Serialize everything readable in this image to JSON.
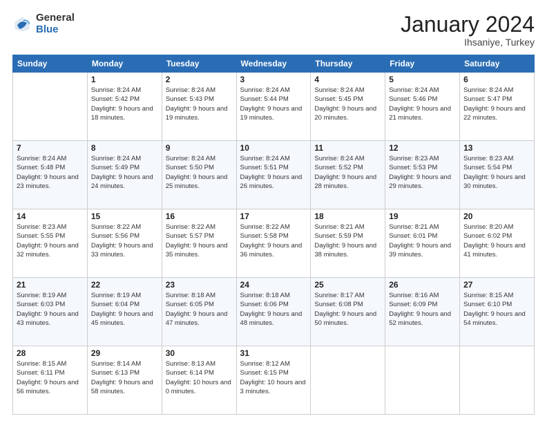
{
  "logo": {
    "general": "General",
    "blue": "Blue"
  },
  "title": "January 2024",
  "location": "Ihsaniye, Turkey",
  "days_of_week": [
    "Sunday",
    "Monday",
    "Tuesday",
    "Wednesday",
    "Thursday",
    "Friday",
    "Saturday"
  ],
  "weeks": [
    [
      {
        "day": "",
        "sunrise": "",
        "sunset": "",
        "daylight": ""
      },
      {
        "day": "1",
        "sunrise": "Sunrise: 8:24 AM",
        "sunset": "Sunset: 5:42 PM",
        "daylight": "Daylight: 9 hours and 18 minutes."
      },
      {
        "day": "2",
        "sunrise": "Sunrise: 8:24 AM",
        "sunset": "Sunset: 5:43 PM",
        "daylight": "Daylight: 9 hours and 19 minutes."
      },
      {
        "day": "3",
        "sunrise": "Sunrise: 8:24 AM",
        "sunset": "Sunset: 5:44 PM",
        "daylight": "Daylight: 9 hours and 19 minutes."
      },
      {
        "day": "4",
        "sunrise": "Sunrise: 8:24 AM",
        "sunset": "Sunset: 5:45 PM",
        "daylight": "Daylight: 9 hours and 20 minutes."
      },
      {
        "day": "5",
        "sunrise": "Sunrise: 8:24 AM",
        "sunset": "Sunset: 5:46 PM",
        "daylight": "Daylight: 9 hours and 21 minutes."
      },
      {
        "day": "6",
        "sunrise": "Sunrise: 8:24 AM",
        "sunset": "Sunset: 5:47 PM",
        "daylight": "Daylight: 9 hours and 22 minutes."
      }
    ],
    [
      {
        "day": "7",
        "sunrise": "Sunrise: 8:24 AM",
        "sunset": "Sunset: 5:48 PM",
        "daylight": "Daylight: 9 hours and 23 minutes."
      },
      {
        "day": "8",
        "sunrise": "Sunrise: 8:24 AM",
        "sunset": "Sunset: 5:49 PM",
        "daylight": "Daylight: 9 hours and 24 minutes."
      },
      {
        "day": "9",
        "sunrise": "Sunrise: 8:24 AM",
        "sunset": "Sunset: 5:50 PM",
        "daylight": "Daylight: 9 hours and 25 minutes."
      },
      {
        "day": "10",
        "sunrise": "Sunrise: 8:24 AM",
        "sunset": "Sunset: 5:51 PM",
        "daylight": "Daylight: 9 hours and 26 minutes."
      },
      {
        "day": "11",
        "sunrise": "Sunrise: 8:24 AM",
        "sunset": "Sunset: 5:52 PM",
        "daylight": "Daylight: 9 hours and 28 minutes."
      },
      {
        "day": "12",
        "sunrise": "Sunrise: 8:23 AM",
        "sunset": "Sunset: 5:53 PM",
        "daylight": "Daylight: 9 hours and 29 minutes."
      },
      {
        "day": "13",
        "sunrise": "Sunrise: 8:23 AM",
        "sunset": "Sunset: 5:54 PM",
        "daylight": "Daylight: 9 hours and 30 minutes."
      }
    ],
    [
      {
        "day": "14",
        "sunrise": "Sunrise: 8:23 AM",
        "sunset": "Sunset: 5:55 PM",
        "daylight": "Daylight: 9 hours and 32 minutes."
      },
      {
        "day": "15",
        "sunrise": "Sunrise: 8:22 AM",
        "sunset": "Sunset: 5:56 PM",
        "daylight": "Daylight: 9 hours and 33 minutes."
      },
      {
        "day": "16",
        "sunrise": "Sunrise: 8:22 AM",
        "sunset": "Sunset: 5:57 PM",
        "daylight": "Daylight: 9 hours and 35 minutes."
      },
      {
        "day": "17",
        "sunrise": "Sunrise: 8:22 AM",
        "sunset": "Sunset: 5:58 PM",
        "daylight": "Daylight: 9 hours and 36 minutes."
      },
      {
        "day": "18",
        "sunrise": "Sunrise: 8:21 AM",
        "sunset": "Sunset: 5:59 PM",
        "daylight": "Daylight: 9 hours and 38 minutes."
      },
      {
        "day": "19",
        "sunrise": "Sunrise: 8:21 AM",
        "sunset": "Sunset: 6:01 PM",
        "daylight": "Daylight: 9 hours and 39 minutes."
      },
      {
        "day": "20",
        "sunrise": "Sunrise: 8:20 AM",
        "sunset": "Sunset: 6:02 PM",
        "daylight": "Daylight: 9 hours and 41 minutes."
      }
    ],
    [
      {
        "day": "21",
        "sunrise": "Sunrise: 8:19 AM",
        "sunset": "Sunset: 6:03 PM",
        "daylight": "Daylight: 9 hours and 43 minutes."
      },
      {
        "day": "22",
        "sunrise": "Sunrise: 8:19 AM",
        "sunset": "Sunset: 6:04 PM",
        "daylight": "Daylight: 9 hours and 45 minutes."
      },
      {
        "day": "23",
        "sunrise": "Sunrise: 8:18 AM",
        "sunset": "Sunset: 6:05 PM",
        "daylight": "Daylight: 9 hours and 47 minutes."
      },
      {
        "day": "24",
        "sunrise": "Sunrise: 8:18 AM",
        "sunset": "Sunset: 6:06 PM",
        "daylight": "Daylight: 9 hours and 48 minutes."
      },
      {
        "day": "25",
        "sunrise": "Sunrise: 8:17 AM",
        "sunset": "Sunset: 6:08 PM",
        "daylight": "Daylight: 9 hours and 50 minutes."
      },
      {
        "day": "26",
        "sunrise": "Sunrise: 8:16 AM",
        "sunset": "Sunset: 6:09 PM",
        "daylight": "Daylight: 9 hours and 52 minutes."
      },
      {
        "day": "27",
        "sunrise": "Sunrise: 8:15 AM",
        "sunset": "Sunset: 6:10 PM",
        "daylight": "Daylight: 9 hours and 54 minutes."
      }
    ],
    [
      {
        "day": "28",
        "sunrise": "Sunrise: 8:15 AM",
        "sunset": "Sunset: 6:11 PM",
        "daylight": "Daylight: 9 hours and 56 minutes."
      },
      {
        "day": "29",
        "sunrise": "Sunrise: 8:14 AM",
        "sunset": "Sunset: 6:13 PM",
        "daylight": "Daylight: 9 hours and 58 minutes."
      },
      {
        "day": "30",
        "sunrise": "Sunrise: 8:13 AM",
        "sunset": "Sunset: 6:14 PM",
        "daylight": "Daylight: 10 hours and 0 minutes."
      },
      {
        "day": "31",
        "sunrise": "Sunrise: 8:12 AM",
        "sunset": "Sunset: 6:15 PM",
        "daylight": "Daylight: 10 hours and 3 minutes."
      },
      {
        "day": "",
        "sunrise": "",
        "sunset": "",
        "daylight": ""
      },
      {
        "day": "",
        "sunrise": "",
        "sunset": "",
        "daylight": ""
      },
      {
        "day": "",
        "sunrise": "",
        "sunset": "",
        "daylight": ""
      }
    ]
  ]
}
